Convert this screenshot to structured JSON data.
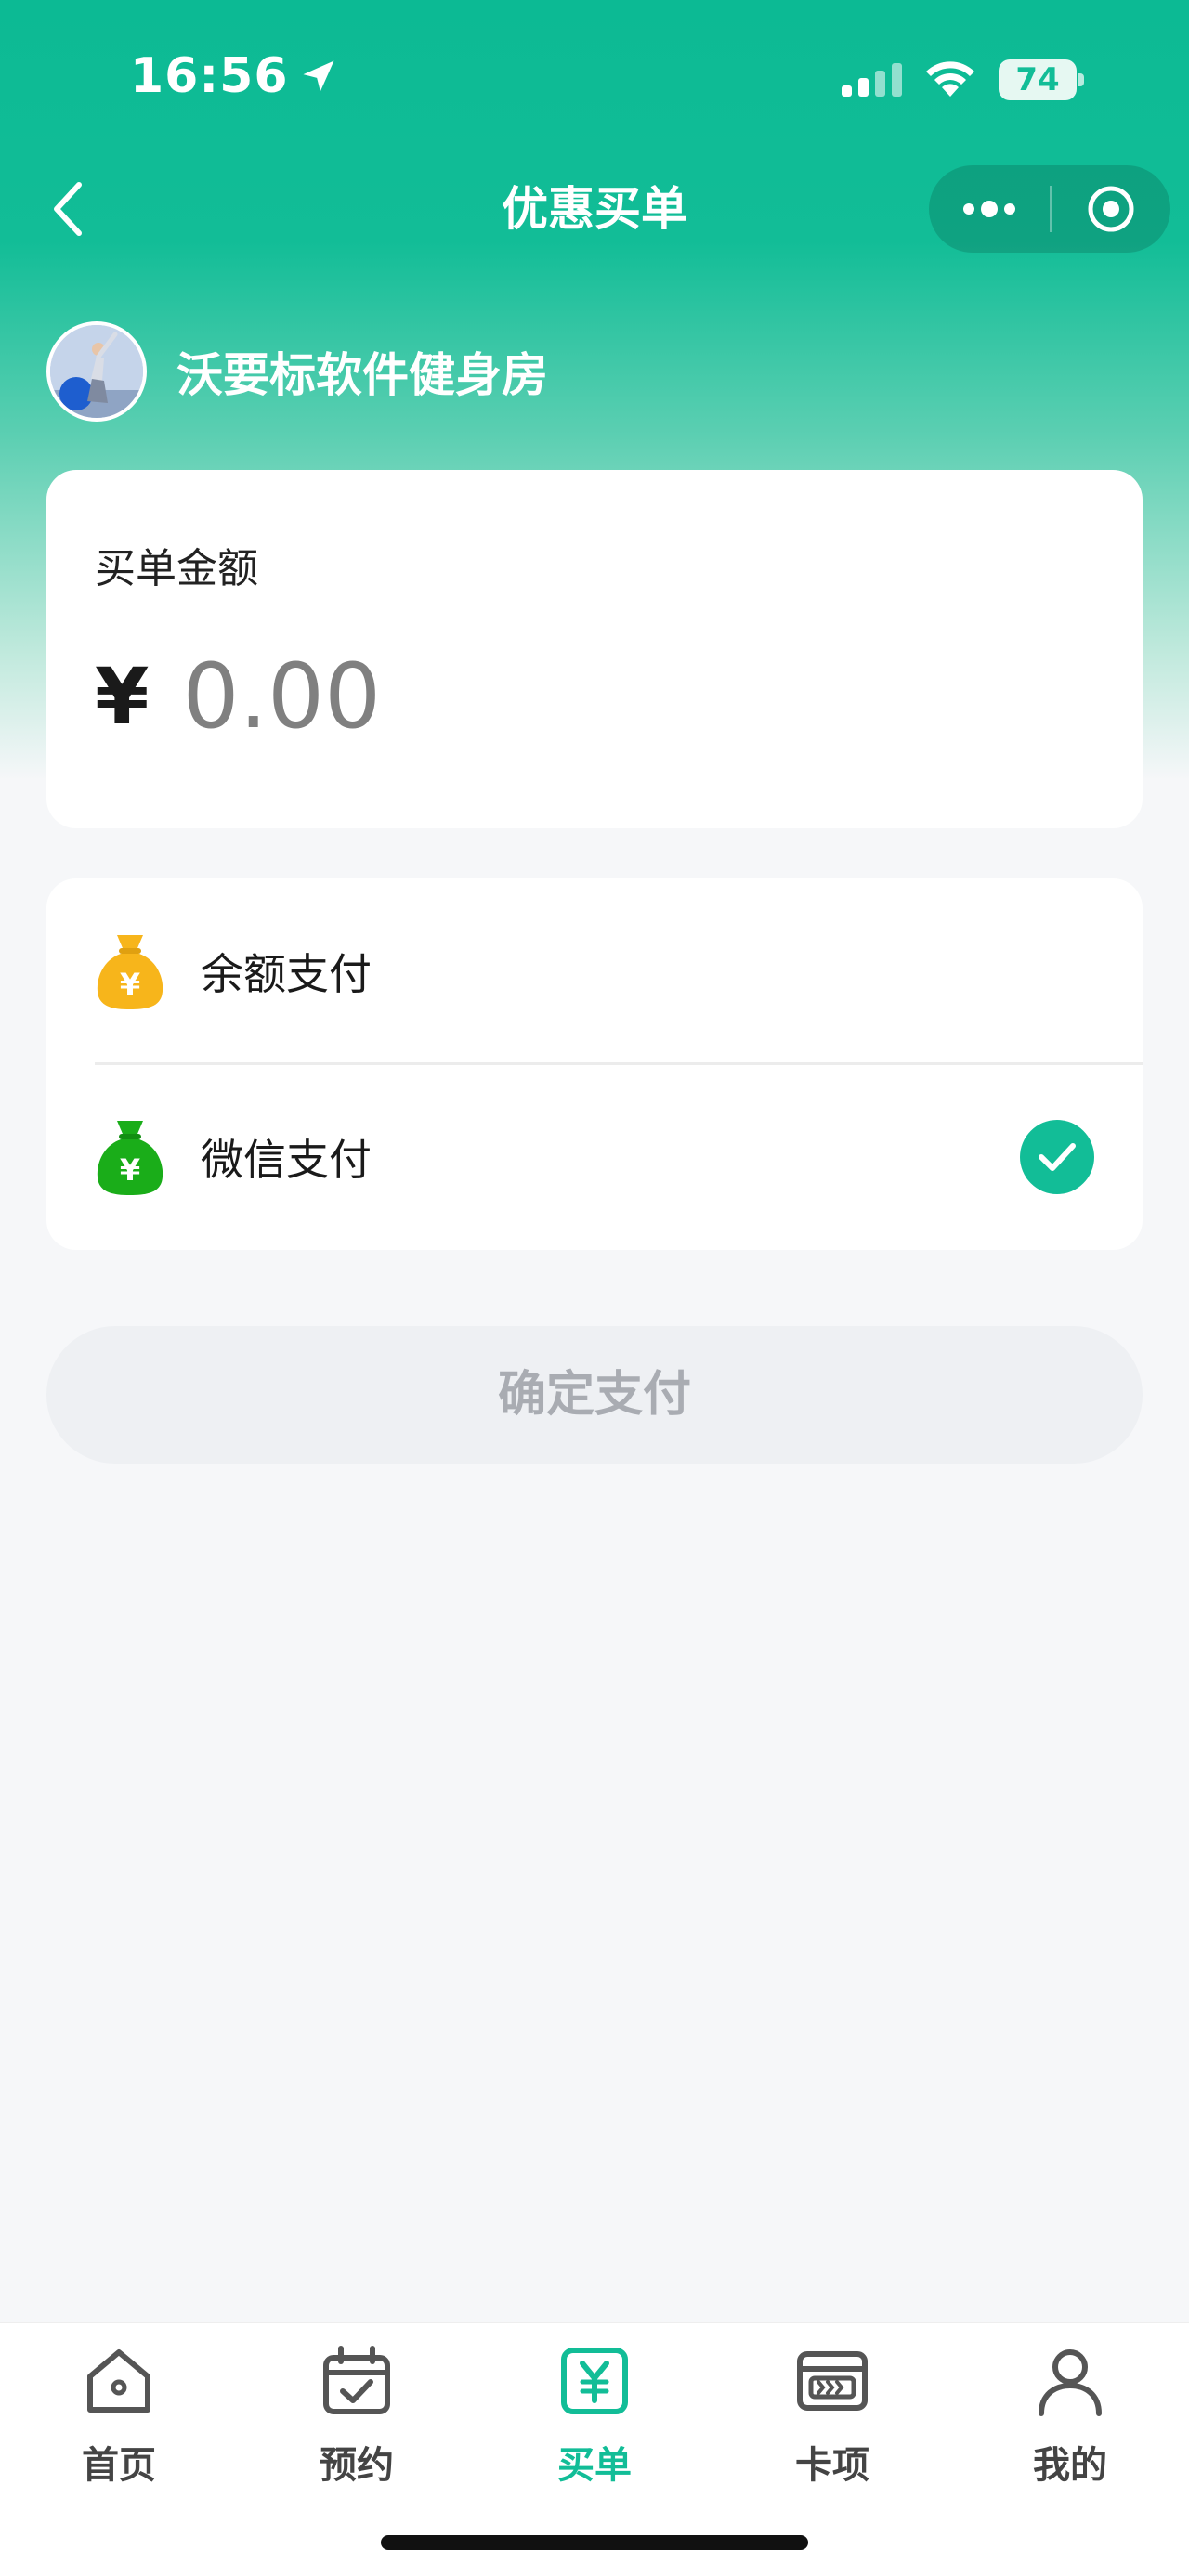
{
  "status_bar": {
    "time": "16:56",
    "battery": "74"
  },
  "nav": {
    "title": "优惠买单"
  },
  "store": {
    "name": "沃要标软件健身房"
  },
  "amount": {
    "label": "买单金额",
    "currency": "¥",
    "value": "0.00"
  },
  "payment": {
    "methods": [
      {
        "label": "余额支付",
        "icon": "money-bag-yellow-icon",
        "color": "#f7b51b",
        "selected": false
      },
      {
        "label": "微信支付",
        "icon": "money-bag-green-icon",
        "color": "#1aad19",
        "selected": true
      }
    ]
  },
  "confirm": {
    "label": "确定支付"
  },
  "tabs": [
    {
      "label": "首页",
      "icon": "home-icon",
      "active": false
    },
    {
      "label": "预约",
      "icon": "calendar-check-icon",
      "active": false
    },
    {
      "label": "买单",
      "icon": "yuan-receipt-icon",
      "active": true
    },
    {
      "label": "卡项",
      "icon": "card-icon",
      "active": false
    },
    {
      "label": "我的",
      "icon": "user-icon",
      "active": false
    }
  ],
  "colors": {
    "accent": "#12bd97",
    "background": "#f6f7f9"
  }
}
